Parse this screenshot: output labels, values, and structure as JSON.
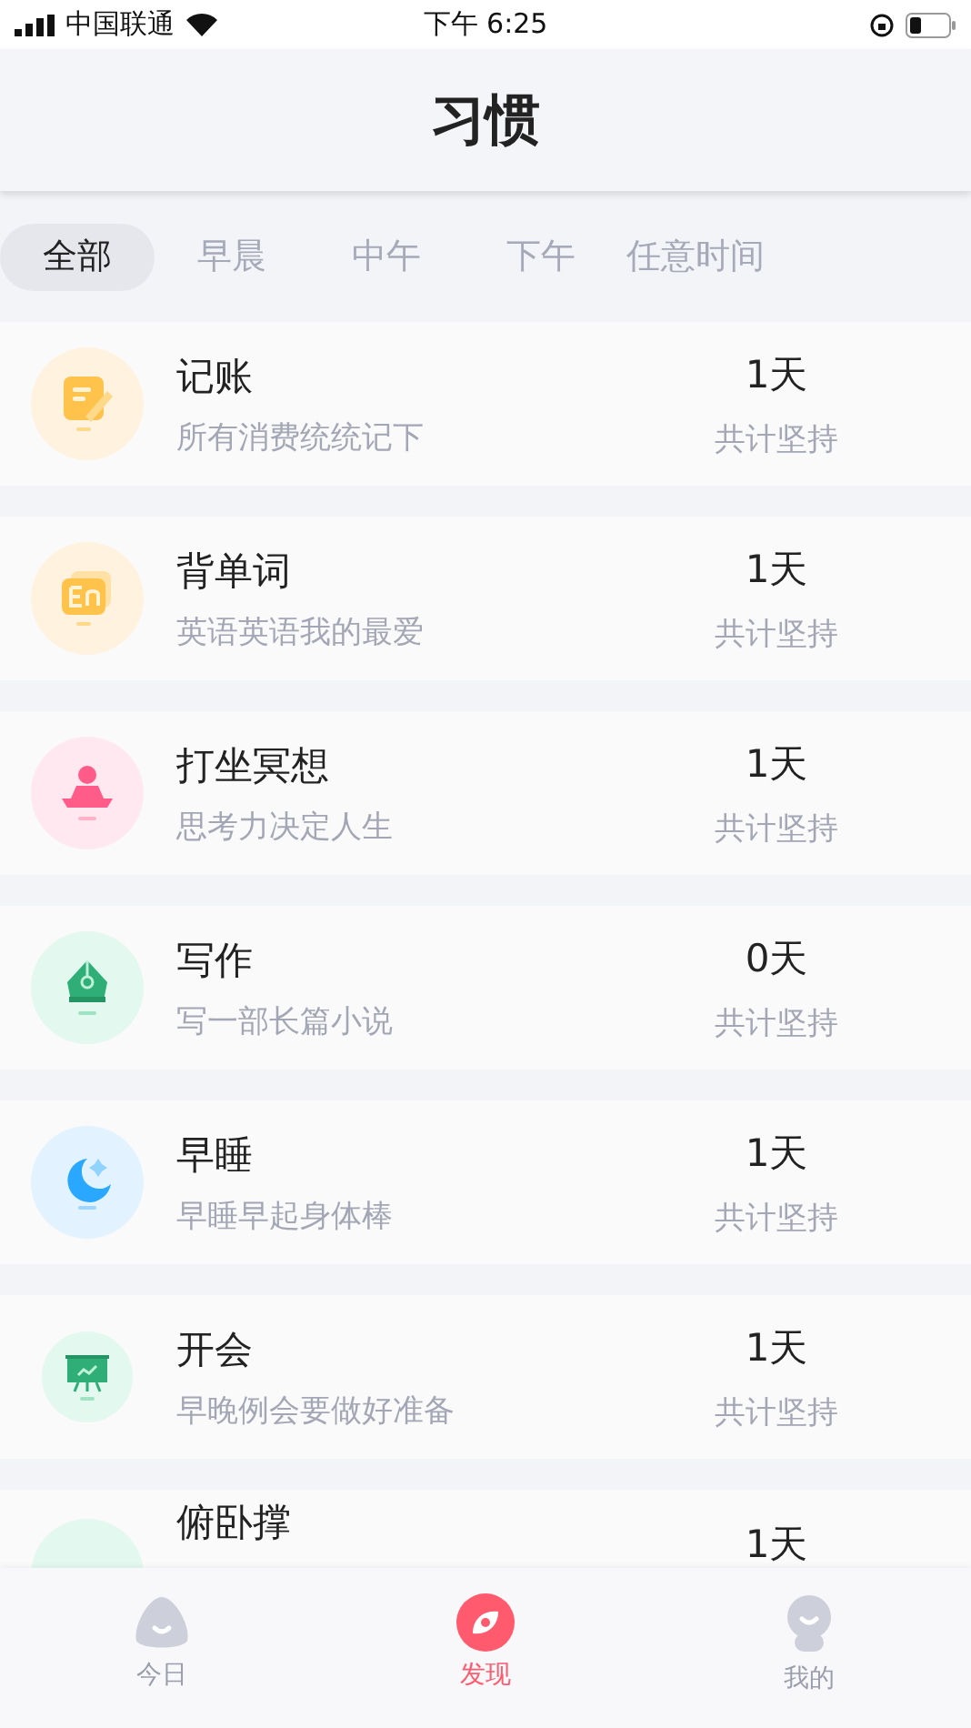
{
  "status_bar": {
    "carrier": "中国联通",
    "time": "下午 6:25"
  },
  "header": {
    "title": "习惯"
  },
  "tabs": [
    {
      "label": "全部",
      "selected": true
    },
    {
      "label": "早晨",
      "selected": false
    },
    {
      "label": "中午",
      "selected": false
    },
    {
      "label": "下午",
      "selected": false
    },
    {
      "label": "任意时间",
      "selected": false
    }
  ],
  "habits": [
    {
      "kind": "notebook",
      "name": "记账",
      "description": "所有消费统统记下",
      "days": "1天",
      "days_label": "共计坚持"
    },
    {
      "kind": "english",
      "name": "背单词",
      "description": "英语英语我的最爱",
      "days": "1天",
      "days_label": "共计坚持"
    },
    {
      "kind": "meditation",
      "name": "打坐冥想",
      "description": "思考力决定人生",
      "days": "1天",
      "days_label": "共计坚持"
    },
    {
      "kind": "pen",
      "name": "写作",
      "description": "写一部长篇小说",
      "days": "0天",
      "days_label": "共计坚持"
    },
    {
      "kind": "moon",
      "name": "早睡",
      "description": "早睡早起身体棒",
      "days": "1天",
      "days_label": "共计坚持"
    },
    {
      "kind": "presentation",
      "name": "开会",
      "description": "早晚例会要做好准备",
      "days": "1天",
      "days_label": "共计坚持"
    },
    {
      "kind": "partial",
      "name": "俯卧撑",
      "days": "1天"
    }
  ],
  "tab_bar": [
    {
      "kind": "today",
      "label": "今日",
      "selected": false
    },
    {
      "kind": "discover",
      "label": "发现",
      "selected": true
    },
    {
      "kind": "profile",
      "label": "我的",
      "selected": false
    }
  ]
}
